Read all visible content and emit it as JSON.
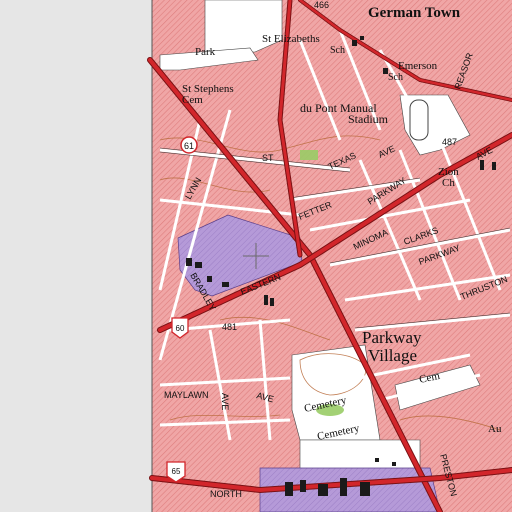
{
  "map": {
    "colors": {
      "margin": "#e6e6e6",
      "urban_tint": "#f0a6a6",
      "hatch": "#d96d6d",
      "road": "#d2262b",
      "road_outline": "#7a1114",
      "street": "#ffffff",
      "street_edge": "#2a2a2a",
      "contour": "#b86a3a",
      "institution": "#b59ad8",
      "open_land": "#ffffff",
      "park_green": "#99cc66",
      "building": "#1a1a1a"
    },
    "labels": {
      "german_town": "German Town",
      "st_elizabeths": "St Elizabeths",
      "sch_1": "Sch",
      "emerson": "Emerson",
      "sch_2": "Sch",
      "park": "Park",
      "st_stephens": "St Stephens",
      "cem_1": "Cem",
      "du_pont_manual": "du Pont Manual",
      "stadium": "Stadium",
      "route_61": "61",
      "route_60": "60",
      "route_487": "487",
      "route_481": "481",
      "route_65": "65",
      "st": "ST",
      "texas": "TEXAS",
      "ave_1": "AVE",
      "lynn": "LYNN",
      "fetter": "FETTER",
      "parkway_1": "PARKWAY",
      "ave_2": "AVE",
      "zion": "Zion",
      "ch": "Ch",
      "minoma": "MINOMA",
      "clarks": "CLARKS",
      "parkway_2": "PARKWAY",
      "thruston": "THRUSTON",
      "eastern": "EASTERN",
      "bradley": "BRADLEY",
      "parkway_village_1": "Parkway",
      "parkway_village_2": "Village",
      "cemetery_1": "Cemetery",
      "cemetery_2": "Cemetery",
      "cem_2": "Cem",
      "ave_3": "AVE",
      "maylawn": "MAYLAWN",
      "ave_4": "AVE",
      "north": "NORTH",
      "preston": "PRESTON",
      "reasor": "REASOR",
      "au": "Au",
      "num_466": "466"
    }
  }
}
